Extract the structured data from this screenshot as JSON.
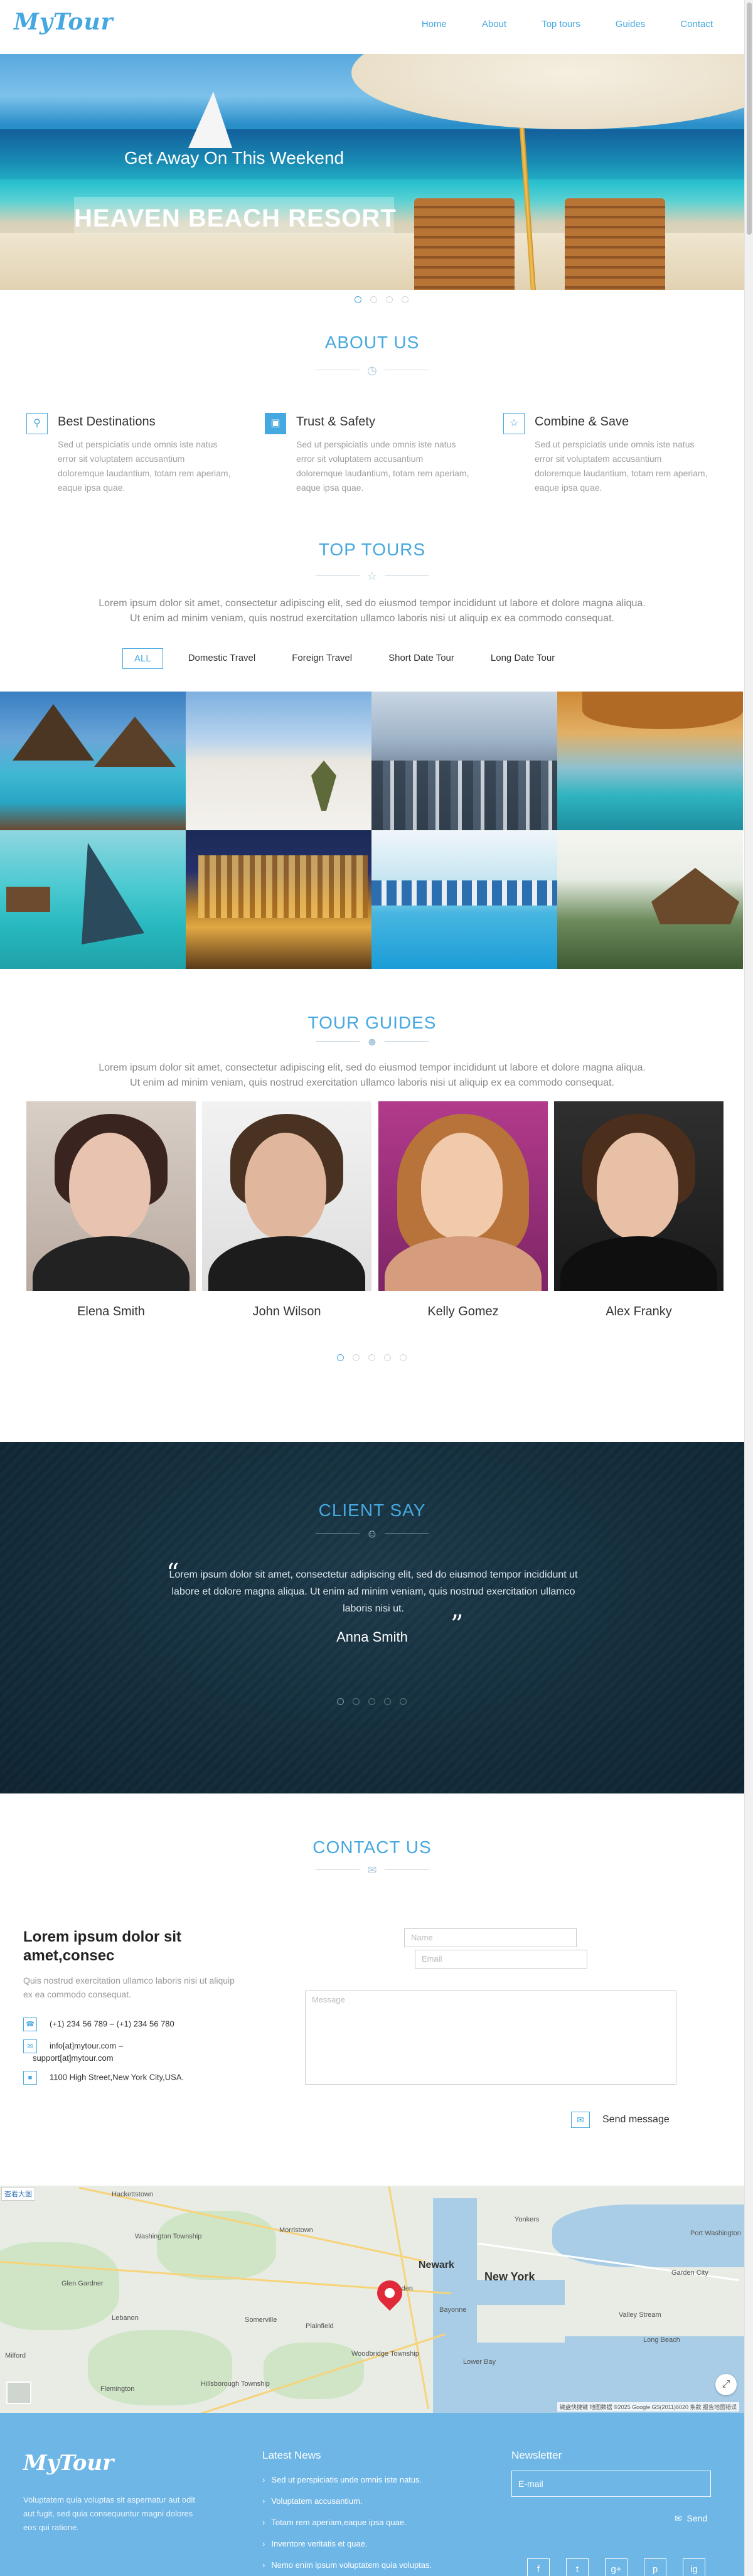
{
  "header": {
    "logo": "MyTour",
    "nav": [
      "Home",
      "About",
      "Top tours",
      "Guides",
      "Contact"
    ]
  },
  "hero": {
    "subtitle": "Get Away On This Weekend",
    "title": "HEAVEN BEACH RESORT",
    "slides": 4,
    "active_slide": 1
  },
  "about": {
    "title": "ABOUT US",
    "features": [
      {
        "icon": "map-pin-icon",
        "title": "Best Destinations",
        "text": "Sed ut perspiciatis unde omnis iste natus error sit voluptatem accusantium doloremque laudantium, totam rem aperiam, eaque ipsa quae."
      },
      {
        "icon": "shield-icon",
        "title": "Trust & Safety",
        "text": "Sed ut perspiciatis unde omnis iste natus error sit voluptatem accusantium doloremque laudantium, totam rem aperiam, eaque ipsa quae."
      },
      {
        "icon": "star-icon",
        "title": "Combine & Save",
        "text": "Sed ut perspiciatis unde omnis iste natus error sit voluptatem accusantium doloremque laudantium, totam rem aperiam, eaque ipsa quae."
      }
    ]
  },
  "tours": {
    "title": "TOP TOURS",
    "lead_1": "Lorem ipsum dolor sit amet, consectetur adipiscing elit, sed do eiusmod tempor incididunt ut labore et dolore magna aliqua.",
    "lead_2": "Ut enim ad minim veniam, quis nostrud exercitation ullamco laboris nisi ut aliquip ex ea commodo consequat.",
    "filters": [
      "ALL",
      "Domestic Travel",
      "Foreign Travel",
      "Short Date Tour",
      "Long Date Tour"
    ],
    "active_filter": "ALL"
  },
  "guides": {
    "title": "TOUR GUIDES",
    "lead_1": "Lorem ipsum dolor sit amet, consectetur adipiscing elit, sed do eiusmod tempor incididunt ut labore et dolore magna aliqua.",
    "lead_2": "Ut enim ad minim veniam, quis nostrud exercitation ullamco laboris nisi ut aliquip ex ea commodo consequat.",
    "people": [
      "Elena Smith",
      "John Wilson",
      "Kelly Gomez",
      "Alex Franky"
    ],
    "pages": 5,
    "active_page": 1
  },
  "client": {
    "title": "CLIENT SAY",
    "quote": "Lorem ipsum dolor sit amet, consectetur adipiscing elit, sed do eiusmod tempor incididunt ut labore et dolore magna aliqua. Ut enim ad minim veniam, quis nostrud exercitation ullamco laboris nisi ut.",
    "author": "Anna Smith",
    "pages": 5,
    "active_page": 1
  },
  "contact": {
    "title": "CONTACT US",
    "heading": "Lorem ipsum dolor sit amet,consec",
    "text": "Quis nostrud exercitation ullamco laboris nisi ut aliquip ex ea commodo consequat.",
    "phones": "(+1) 234 56 789   –   (+1) 234 56 780",
    "emails_1": "info[at]mytour.com   –",
    "emails_2": "support[at]mytour.com",
    "address": "1100 High Street,New York City,USA.",
    "name_placeholder": "Name",
    "email_placeholder": "Email",
    "message_placeholder": "Message",
    "send_label": "Send message"
  },
  "map": {
    "corner_label": "查看大图",
    "big_cities": [
      "Newark",
      "New York"
    ],
    "places": [
      "Hackettstown",
      "Morristown",
      "Washington Township",
      "Glen Gardner",
      "Lebanon",
      "Plainfield",
      "Linden",
      "Bayonne",
      "Yonkers",
      "Port Washington",
      "Garden City",
      "Valley Stream",
      "Long Beach",
      "Milford",
      "Flemington",
      "Hillsborough Township",
      "Somerville",
      "Woodbridge Township",
      "Lower Bay"
    ],
    "attribution": "键盘快捷键   地图数据 ©2025 Google  GS(2011)6020   条款   报告地图错误"
  },
  "footer": {
    "logo": "MyTour",
    "desc": "Voluptatem quia voluptas sit aspernatur aut odit aut fugit, sed quia consequuntur magni dolores eos qui ratione.",
    "news_title": "Latest News",
    "news": [
      "Sed ut perspiciatis unde omnis iste natus.",
      "Voluptatem accusantium.",
      "Totam rem aperiam,eaque ipsa quae.",
      "Inventore veritatis et quae.",
      "Nemo enim ipsum voluptatem quia voluptas."
    ],
    "newsletter_title": "Newsletter",
    "email_placeholder": "E-mail",
    "send_label": "Send",
    "social": [
      "f",
      "t",
      "g+",
      "p",
      "ig"
    ]
  },
  "colors": {
    "accent": "#46a8e0",
    "footer_bg": "#6eb6e6",
    "client_bg": "#15303f"
  }
}
